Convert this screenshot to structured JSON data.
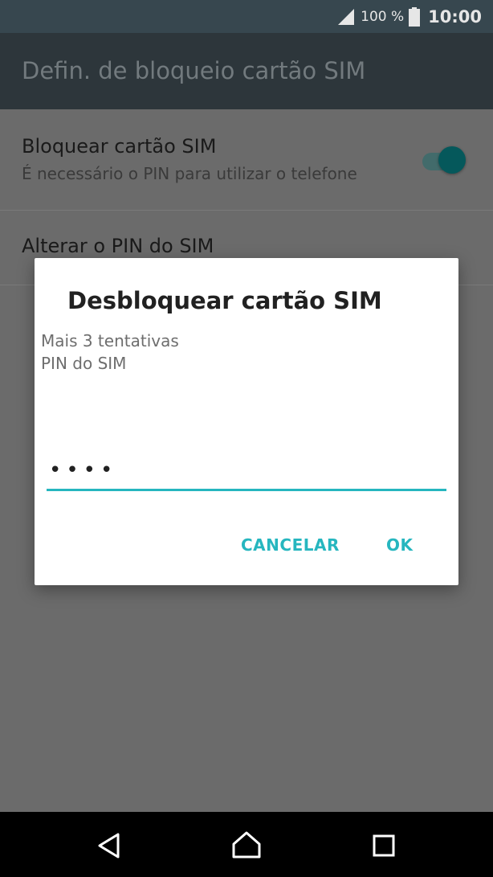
{
  "status_bar": {
    "battery_percent": "100 %",
    "time": "10:00",
    "signal_icon": "signal-icon",
    "battery_icon": "battery-icon"
  },
  "app_bar": {
    "title": "Defin. de bloqueio cartão SIM"
  },
  "settings": {
    "lock_sim": {
      "title": "Bloquear cartão SIM",
      "summary": "É necessário o PIN para utilizar o telefone",
      "enabled": true
    },
    "change_pin": {
      "title": "Alterar o PIN do SIM"
    }
  },
  "dialog": {
    "title": "Desbloquear cartão SIM",
    "attempts": "Mais 3 tentativas",
    "prompt": "PIN do SIM",
    "pin_value": "••••",
    "cancel_label": "CANCELAR",
    "ok_label": "OK"
  },
  "colors": {
    "accent": "#26b6bf",
    "toggle_on": "#05585b",
    "status_bar": "#37474f"
  },
  "nav_bar": {
    "back_icon": "back-triangle-icon",
    "home_icon": "home-icon",
    "recents_icon": "recents-square-icon"
  }
}
